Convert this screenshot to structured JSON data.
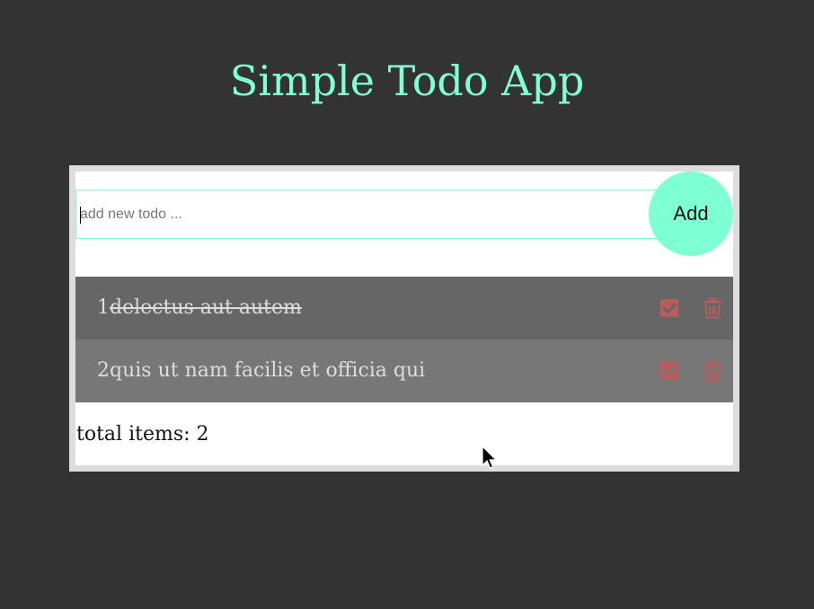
{
  "app": {
    "title": "Simple Todo App"
  },
  "input": {
    "placeholder": "add new todo ...",
    "value": ""
  },
  "add_button": {
    "label": "Add"
  },
  "todos": [
    {
      "number": "1",
      "text": "delectus aut autem",
      "completed": true
    },
    {
      "number": "2",
      "text": "quis ut nam facilis et officia qui",
      "completed": false
    }
  ],
  "footer": {
    "total_label": "total items: 2"
  },
  "colors": {
    "background": "#333333",
    "accent": "#7fffd4",
    "done_row": "#666666",
    "pending_row": "#777777",
    "icon": "#b85c5c"
  },
  "icons": {
    "complete": "check-square-icon",
    "delete": "trash-icon"
  }
}
